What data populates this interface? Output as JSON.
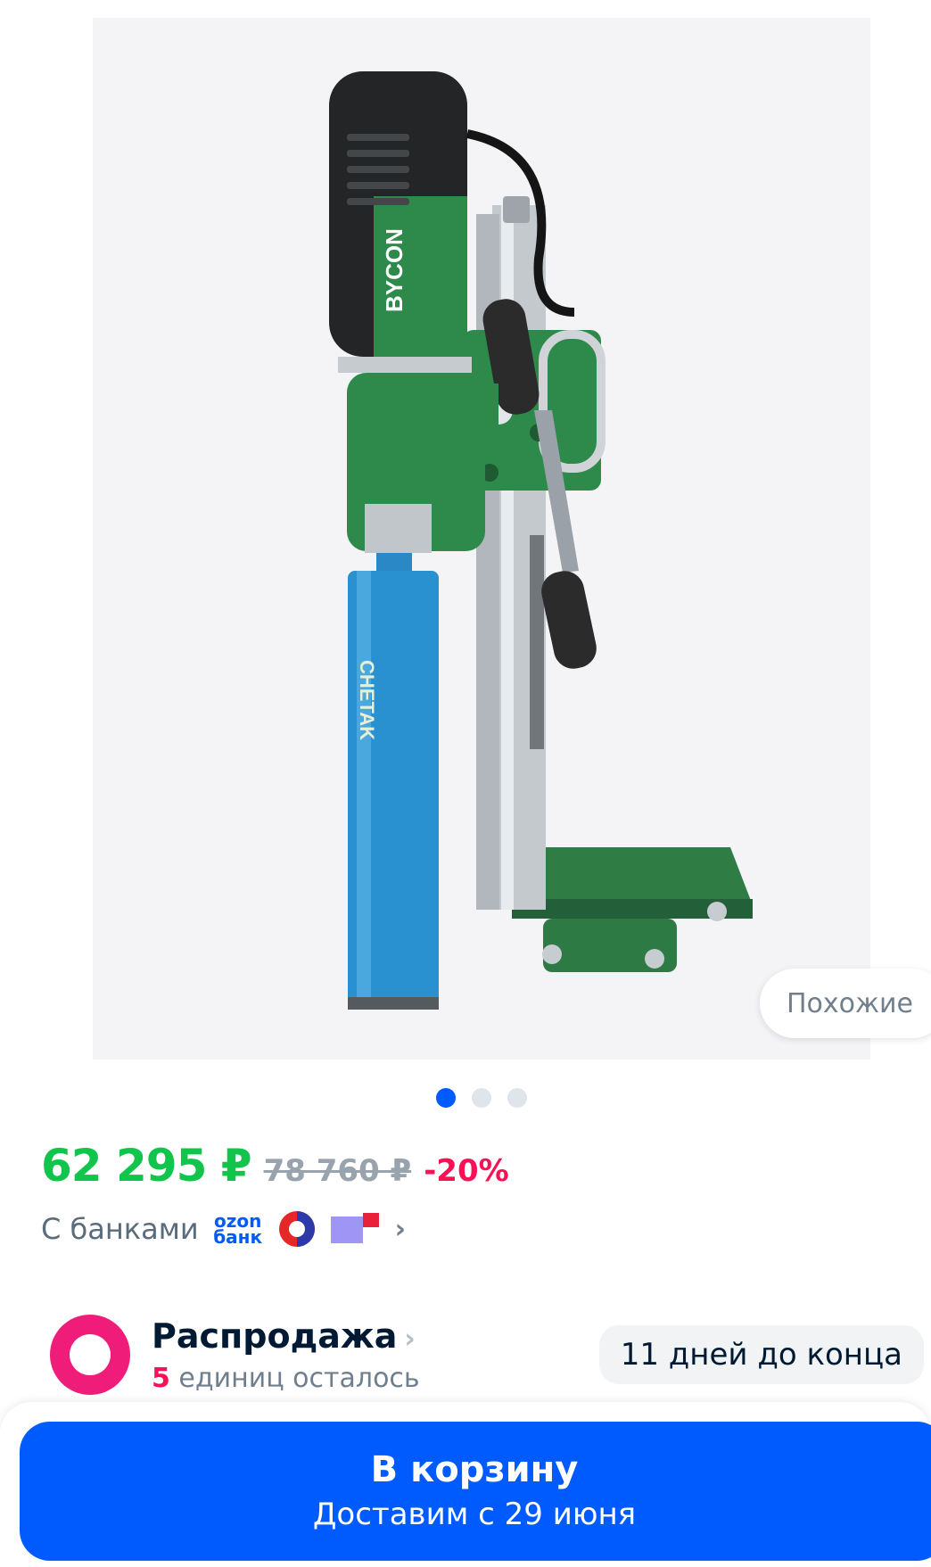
{
  "gallery": {
    "image_alt": "BYCON",
    "bit_label": "CHETAK",
    "similar_label": "Похожие",
    "dots_count": 3,
    "active_dot": 1
  },
  "price": {
    "current": "62 295 ₽",
    "old": "78 760 ₽",
    "discount": "-20%"
  },
  "banks": {
    "label": "С банками",
    "ozon_top": "ozon",
    "ozon_bottom": "банк",
    "accent_color": "#005bff"
  },
  "sale": {
    "title": "Распродажа",
    "units_count": "5",
    "units_text": "единиц осталось",
    "days_left": "11 дней до конца"
  },
  "cart": {
    "label": "В корзину",
    "delivery": "Доставим с 29 июня"
  }
}
